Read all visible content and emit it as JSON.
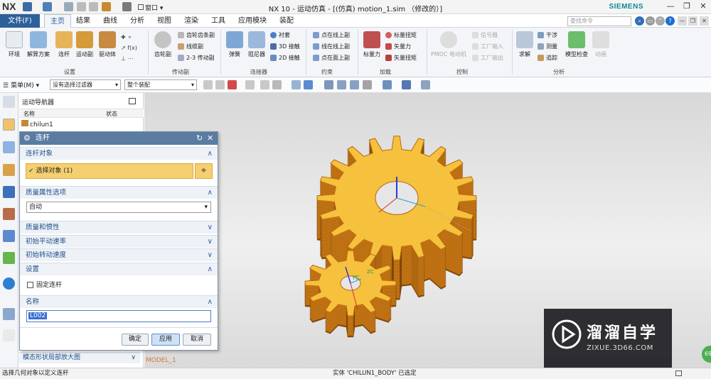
{
  "titlebar": {
    "logo": "NX",
    "title": "NX 10 - 运动仿真 - [(仿真) motion_1.sim （修改的）]",
    "brand": "SIEMENS",
    "window_menu": "窗口"
  },
  "tabs": {
    "file": "文件(F)",
    "items": [
      "主页",
      "结果",
      "曲线",
      "分析",
      "视图",
      "渲染",
      "工具",
      "应用模块",
      "装配"
    ],
    "active": "主页",
    "search_placeholder": "查找命令"
  },
  "ribbon": {
    "groups": {
      "setup": "设置",
      "drive": "传动副",
      "connectors": "连接器",
      "constraints": "约束",
      "loads": "加载",
      "control": "控制",
      "analysis": "分析"
    },
    "big": {
      "env": "环境",
      "solve_plan": "解算方案",
      "link": "连杆",
      "motion_pair": "运动副",
      "driver": "驱动体",
      "gear_pair": "齿轮副",
      "spring": "弹簧",
      "damper": "阻尼器",
      "scalar_force": "标量力",
      "pmdc": "PMDC 电动机",
      "solve": "求解",
      "model_check": "模型检查",
      "animation": "动画"
    },
    "small": {
      "gear_rack": "齿轮齿条副",
      "cable": "线缆副",
      "two_three": "2-3 传动副",
      "bushing": "衬套",
      "contact3d": "3D 接触",
      "contact2d": "2D 接触",
      "pt_on_line": "点在线上副",
      "line_on_line": "线在线上副",
      "pt_on_face": "点在面上副",
      "scalar_torque": "标量扭矩",
      "vector_force": "矢量力",
      "vector_torque": "矢量扭矩",
      "signal": "信号器",
      "plant_input": "工厂输入",
      "plant_output": "工厂输出",
      "interference": "干涉",
      "measure": "测量",
      "trace": "追踪"
    }
  },
  "toolbar2": {
    "menu": "菜单(M)",
    "filter": "没有选择过滤器",
    "scope": "整个装配"
  },
  "navigator": {
    "title": "运动导航器",
    "col_name": "名称",
    "col_status": "状态",
    "root": "chilun1",
    "bottom_panel": "模态形状局部放大图"
  },
  "dialog": {
    "title": "连杆",
    "sec_link_object": "连杆对象",
    "select_object": "选择对象 (1)",
    "sec_mass_props": "质量属性选项",
    "mass_option": "自动",
    "sec_mass_inertia": "质量和惯性",
    "sec_init_trans": "初始平动速率",
    "sec_init_rot": "初始转动速度",
    "sec_settings": "设置",
    "fixed_link": "固定连杆",
    "sec_name": "名称",
    "name_value": "L002",
    "ok": "确定",
    "apply": "应用",
    "cancel": "取消"
  },
  "viewport": {
    "yc_label": "YC",
    "model_label": "MODEL_1",
    "zc_label": "ZC"
  },
  "status": {
    "left": "选择几何对象以定义连杆",
    "center": "实体 'CHILUN1_BODY' 已选定"
  },
  "watermark": {
    "text": "溜溜自学",
    "url": "ZIXUE.3D66.COM",
    "corner_badge": "69"
  },
  "colors": {
    "gear": "#f6c13c",
    "gear_dark": "#d27e16",
    "accent": "#2d5f9a",
    "select_row": "#f5cf70"
  }
}
